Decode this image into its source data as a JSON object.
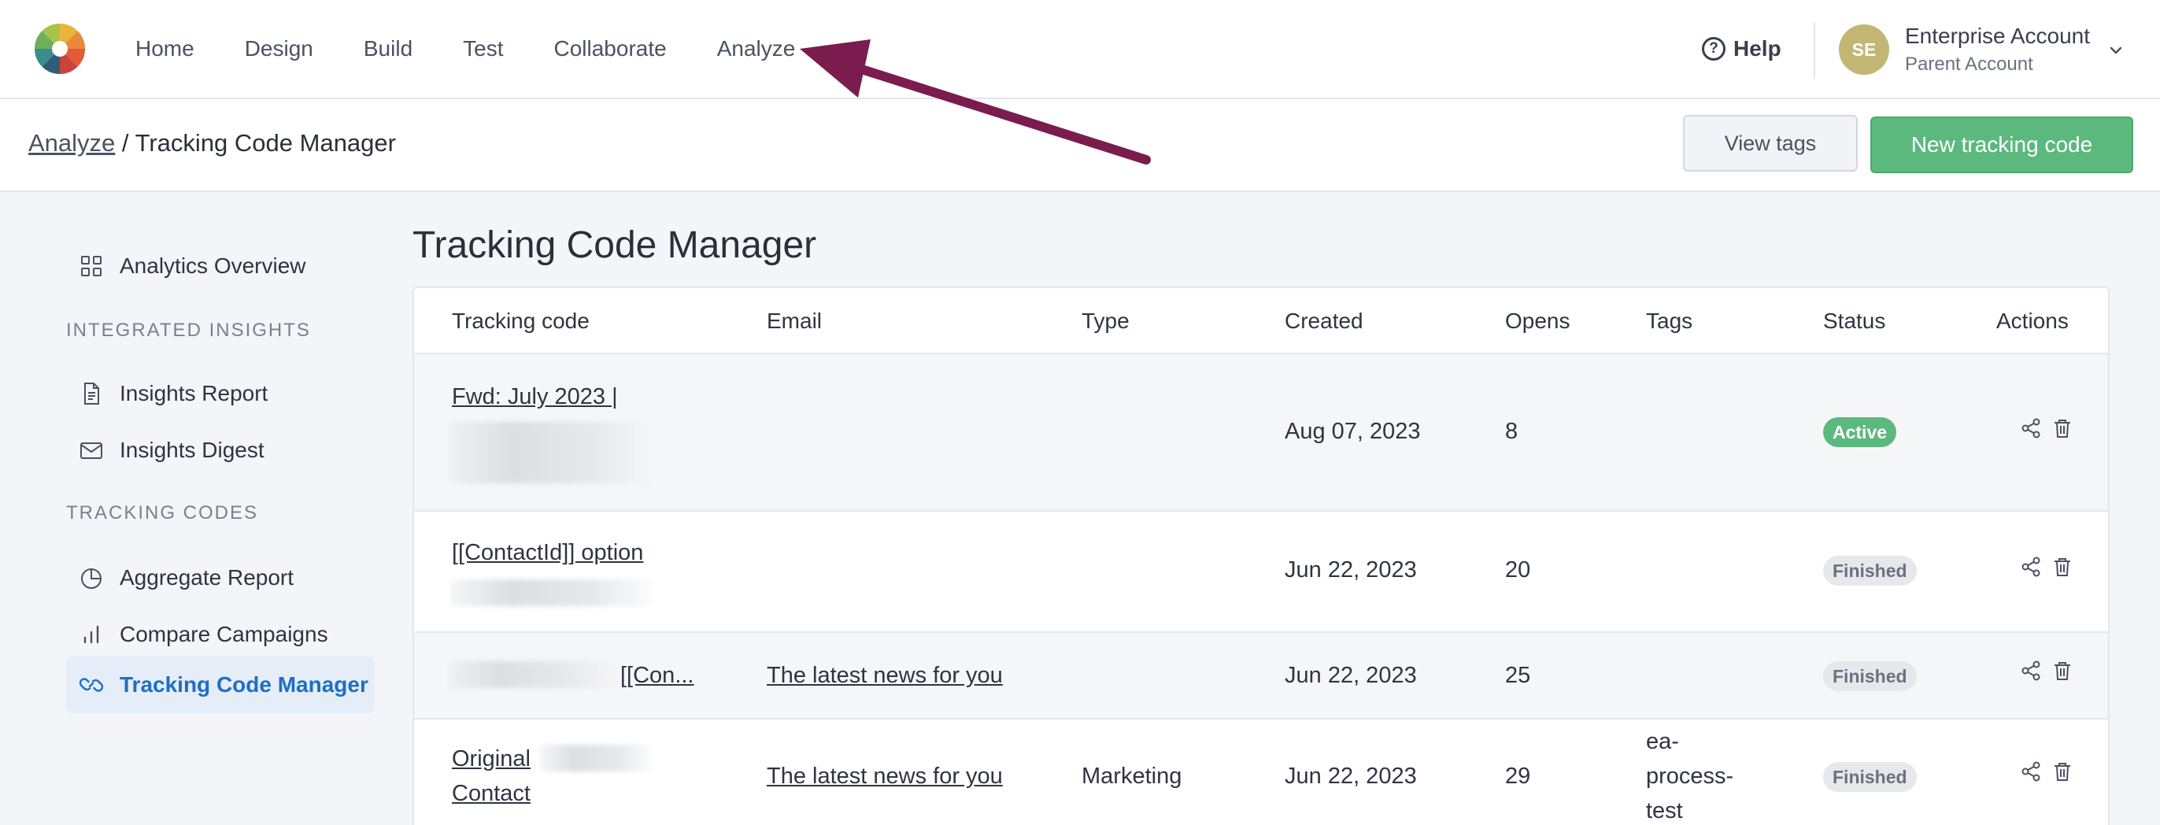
{
  "nav": {
    "items": [
      {
        "label": "Home"
      },
      {
        "label": "Design"
      },
      {
        "label": "Build"
      },
      {
        "label": "Test"
      },
      {
        "label": "Collaborate"
      },
      {
        "label": "Analyze"
      }
    ],
    "help_label": "Help",
    "account": {
      "initials": "SE",
      "name": "Enterprise Account",
      "subtitle": "Parent Account"
    }
  },
  "subheader": {
    "breadcrumb_root": "Analyze",
    "breadcrumb_sep": " / ",
    "breadcrumb_current": "Tracking Code Manager",
    "view_tags_label": "View tags",
    "new_tracking_label": "New tracking code"
  },
  "sidebar": {
    "overview_label": "Analytics Overview",
    "section_insights": "INTEGRATED INSIGHTS",
    "insights_report_label": "Insights Report",
    "insights_digest_label": "Insights Digest",
    "section_tracking": "TRACKING CODES",
    "aggregate_label": "Aggregate Report",
    "compare_label": "Compare Campaigns",
    "manager_label": "Tracking Code Manager"
  },
  "main": {
    "title": "Tracking Code Manager",
    "columns": [
      "Tracking code",
      "Email",
      "Type",
      "Created",
      "Opens",
      "Tags",
      "Status",
      "Actions"
    ],
    "rows": [
      {
        "code": "Fwd: July 2023 |",
        "email": "",
        "type": "",
        "created": "Aug 07, 2023",
        "opens": "8",
        "tags": "",
        "status": "Active"
      },
      {
        "code": "[[ContactId]] option",
        "email": "",
        "type": "",
        "created": "Jun 22, 2023",
        "opens": "20",
        "tags": "",
        "status": "Finished"
      },
      {
        "code": "[[Con...",
        "email": "The latest news for you",
        "type": "",
        "created": "Jun 22, 2023",
        "opens": "25",
        "tags": "",
        "status": "Finished"
      },
      {
        "code_line1": "Original",
        "code_line2": "Contact",
        "email": "The latest news for you",
        "type": "Marketing",
        "created": "Jun 22, 2023",
        "opens": "29",
        "tags_line1": "ea-",
        "tags_line2": "process-",
        "tags_line3": "test",
        "status": "Finished"
      }
    ]
  },
  "colors": {
    "accent": "#1d6fc4",
    "primary_button": "#5cb97d",
    "annotation_arrow": "#7b1c4e",
    "avatar": "#c1b773"
  },
  "icons": [
    "logo-icon",
    "help-icon",
    "chevron-down-icon",
    "grid-icon",
    "document-icon",
    "mail-icon",
    "pie-chart-icon",
    "bar-chart-icon",
    "link-icon",
    "share-icon",
    "trash-icon",
    "annotation-arrow"
  ]
}
